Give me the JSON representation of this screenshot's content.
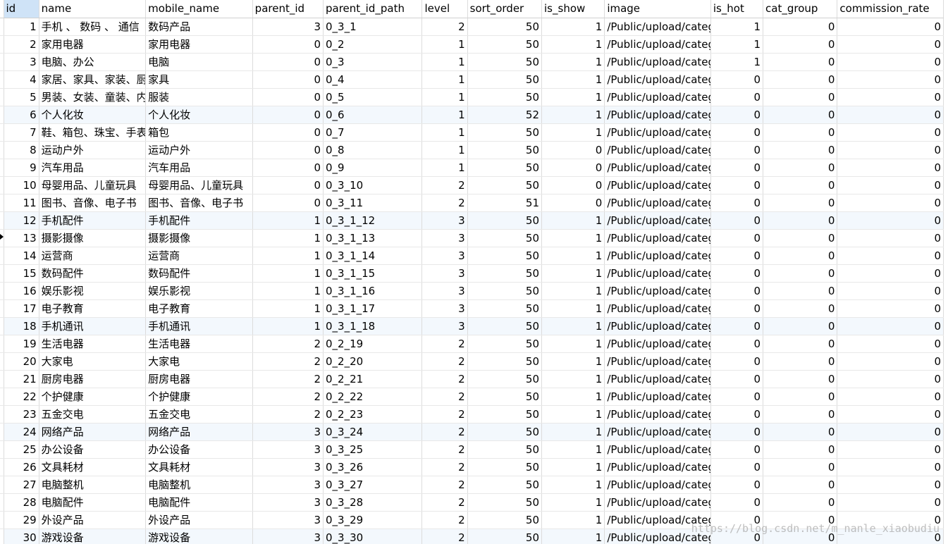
{
  "columns": [
    "id",
    "name",
    "mobile_name",
    "parent_id",
    "parent_id_path",
    "level",
    "sort_order",
    "is_show",
    "image",
    "is_hot",
    "cat_group",
    "commission_rate"
  ],
  "rows": [
    [
      "1",
      "手机 、 数码 、 通信",
      "数码产品",
      "3",
      "0_3_1",
      "2",
      "50",
      "1",
      "/Public/upload/categ",
      "1",
      "0",
      "0"
    ],
    [
      "2",
      "家用电器",
      "家用电器",
      "0",
      "0_2",
      "1",
      "50",
      "1",
      "/Public/upload/categ",
      "1",
      "0",
      "0"
    ],
    [
      "3",
      "电脑、办公",
      "电脑",
      "0",
      "0_3",
      "1",
      "50",
      "1",
      "/Public/upload/categ",
      "1",
      "0",
      "0"
    ],
    [
      "4",
      "家居、家具、家装、厨",
      "家具",
      "0",
      "0_4",
      "1",
      "50",
      "1",
      "/Public/upload/categ",
      "0",
      "0",
      "0"
    ],
    [
      "5",
      "男装、女装、童装、内",
      "服装",
      "0",
      "0_5",
      "1",
      "50",
      "1",
      "/Public/upload/categ",
      "0",
      "0",
      "0"
    ],
    [
      "6",
      "个人化妆",
      "个人化妆",
      "0",
      "0_6",
      "1",
      "52",
      "1",
      "/Public/upload/categ",
      "0",
      "0",
      "0"
    ],
    [
      "7",
      "鞋、箱包、珠宝、手表",
      "箱包",
      "0",
      "0_7",
      "1",
      "50",
      "1",
      "/Public/upload/categ",
      "0",
      "0",
      "0"
    ],
    [
      "8",
      "运动户外",
      "运动户外",
      "0",
      "0_8",
      "1",
      "50",
      "0",
      "/Public/upload/categ",
      "0",
      "0",
      "0"
    ],
    [
      "9",
      "汽车用品",
      "汽车用品",
      "0",
      "0_9",
      "1",
      "50",
      "0",
      "/Public/upload/categ",
      "0",
      "0",
      "0"
    ],
    [
      "10",
      "母婴用品、儿童玩具",
      "母婴用品、儿童玩具",
      "0",
      "0_3_10",
      "2",
      "50",
      "0",
      "/Public/upload/categ",
      "0",
      "0",
      "0"
    ],
    [
      "11",
      "图书、音像、电子书",
      "图书、音像、电子书",
      "0",
      "0_3_11",
      "2",
      "51",
      "0",
      "/Public/upload/categ",
      "0",
      "0",
      "0"
    ],
    [
      "12",
      "手机配件",
      "手机配件",
      "1",
      "0_3_1_12",
      "3",
      "50",
      "1",
      "/Public/upload/categ",
      "0",
      "0",
      "0"
    ],
    [
      "13",
      "摄影摄像",
      "摄影摄像",
      "1",
      "0_3_1_13",
      "3",
      "50",
      "1",
      "/Public/upload/categ",
      "0",
      "0",
      "0"
    ],
    [
      "14",
      "运营商",
      "运营商",
      "1",
      "0_3_1_14",
      "3",
      "50",
      "1",
      "/Public/upload/categ",
      "0",
      "0",
      "0"
    ],
    [
      "15",
      "数码配件",
      "数码配件",
      "1",
      "0_3_1_15",
      "3",
      "50",
      "1",
      "/Public/upload/categ",
      "0",
      "0",
      "0"
    ],
    [
      "16",
      "娱乐影视",
      "娱乐影视",
      "1",
      "0_3_1_16",
      "3",
      "50",
      "1",
      "/Public/upload/categ",
      "0",
      "0",
      "0"
    ],
    [
      "17",
      "电子教育",
      "电子教育",
      "1",
      "0_3_1_17",
      "3",
      "50",
      "1",
      "/Public/upload/categ",
      "0",
      "0",
      "0"
    ],
    [
      "18",
      "手机通讯",
      "手机通讯",
      "1",
      "0_3_1_18",
      "3",
      "50",
      "1",
      "/Public/upload/categ",
      "0",
      "0",
      "0"
    ],
    [
      "19",
      "生活电器",
      "生活电器",
      "2",
      "0_2_19",
      "2",
      "50",
      "1",
      "/Public/upload/categ",
      "0",
      "0",
      "0"
    ],
    [
      "20",
      "大家电",
      "大家电",
      "2",
      "0_2_20",
      "2",
      "50",
      "1",
      "/Public/upload/categ",
      "0",
      "0",
      "0"
    ],
    [
      "21",
      "厨房电器",
      "厨房电器",
      "2",
      "0_2_21",
      "2",
      "50",
      "1",
      "/Public/upload/categ",
      "0",
      "0",
      "0"
    ],
    [
      "22",
      "个护健康",
      "个护健康",
      "2",
      "0_2_22",
      "2",
      "50",
      "1",
      "/Public/upload/categ",
      "0",
      "0",
      "0"
    ],
    [
      "23",
      "五金交电",
      "五金交电",
      "2",
      "0_2_23",
      "2",
      "50",
      "1",
      "/Public/upload/categ",
      "0",
      "0",
      "0"
    ],
    [
      "24",
      "网络产品",
      "网络产品",
      "3",
      "0_3_24",
      "2",
      "50",
      "1",
      "/Public/upload/categ",
      "0",
      "0",
      "0"
    ],
    [
      "25",
      "办公设备",
      "办公设备",
      "3",
      "0_3_25",
      "2",
      "50",
      "1",
      "/Public/upload/categ",
      "0",
      "0",
      "0"
    ],
    [
      "26",
      "文具耗材",
      "文具耗材",
      "3",
      "0_3_26",
      "2",
      "50",
      "1",
      "/Public/upload/categ",
      "0",
      "0",
      "0"
    ],
    [
      "27",
      "电脑整机",
      "电脑整机",
      "3",
      "0_3_27",
      "2",
      "50",
      "1",
      "/Public/upload/categ",
      "0",
      "0",
      "0"
    ],
    [
      "28",
      "电脑配件",
      "电脑配件",
      "3",
      "0_3_28",
      "2",
      "50",
      "1",
      "/Public/upload/categ",
      "0",
      "0",
      "0"
    ],
    [
      "29",
      "外设产品",
      "外设产品",
      "3",
      "0_3_29",
      "2",
      "50",
      "1",
      "/Public/upload/categ",
      "0",
      "0",
      "0"
    ],
    [
      "30",
      "游戏设备",
      "游戏设备",
      "3",
      "0_3_30",
      "2",
      "50",
      "1",
      "/Public/upload/categ",
      "0",
      "0",
      "0"
    ]
  ],
  "numeric_columns": [
    0,
    3,
    5,
    6,
    7,
    9,
    10,
    11
  ],
  "highlight_rows": [
    6,
    12,
    18,
    24,
    30
  ],
  "selected_column": 0,
  "watermark": "https://blog.csdn.net/m_nanle_xiaobudiu"
}
